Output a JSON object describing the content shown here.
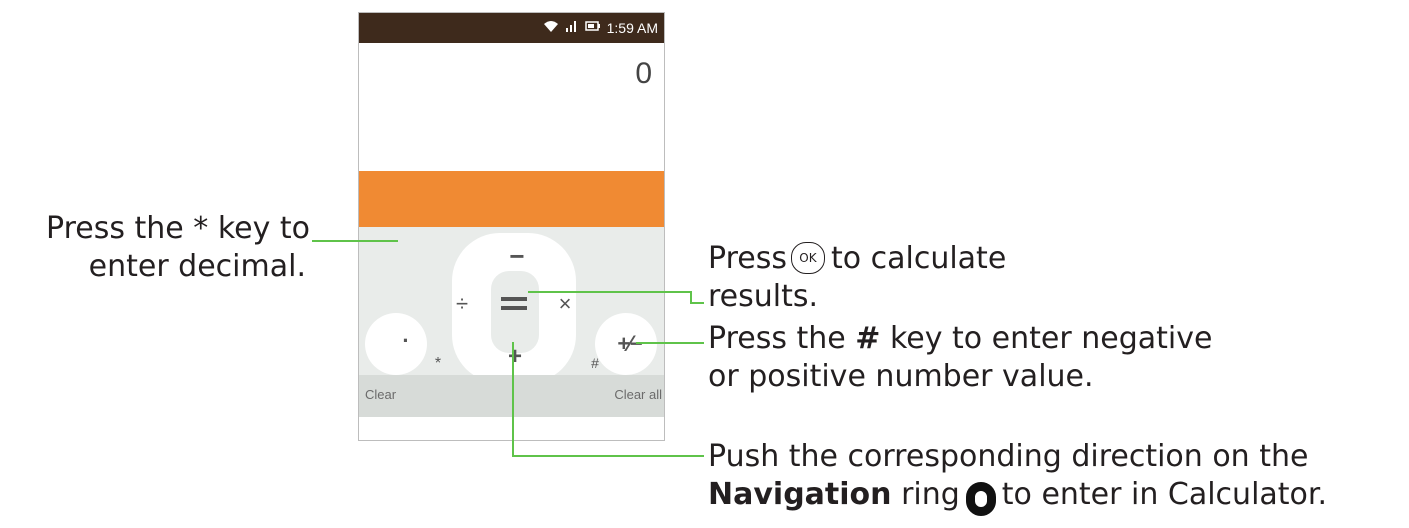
{
  "phone": {
    "status": {
      "time": "1:59 AM",
      "icons": [
        "wifi-icon",
        "signal-icon",
        "battery-icon"
      ]
    },
    "display_value": "0",
    "keys": {
      "minus": "−",
      "divide": "÷",
      "times": "×",
      "plus": "+",
      "decimal": "·",
      "plus_minus": "+⁄−",
      "star": "*",
      "hash": "#"
    },
    "softkeys": {
      "left": "Clear",
      "right": "Clear all"
    }
  },
  "annotations": {
    "decimal": {
      "line1": "Press the * key to",
      "line2": "enter decimal."
    },
    "ok": {
      "prefix": "Press",
      "badge": "OK",
      "suffix": "to calculate",
      "line2": "results."
    },
    "hash": {
      "prefix": "Press the",
      "key": "#",
      "suffix": "key to enter negative",
      "line2": "or positive number value."
    },
    "nav": {
      "line1": "Push the corresponding direction on the",
      "bold": "Navigation",
      "mid": "ring",
      "suffix": "to enter in Calculator."
    }
  },
  "colors": {
    "status_bar": "#3e2a1c",
    "accent_orange": "#f08a33",
    "callout_green": "#5fc34a",
    "keypad_bg": "#e9ecea"
  }
}
